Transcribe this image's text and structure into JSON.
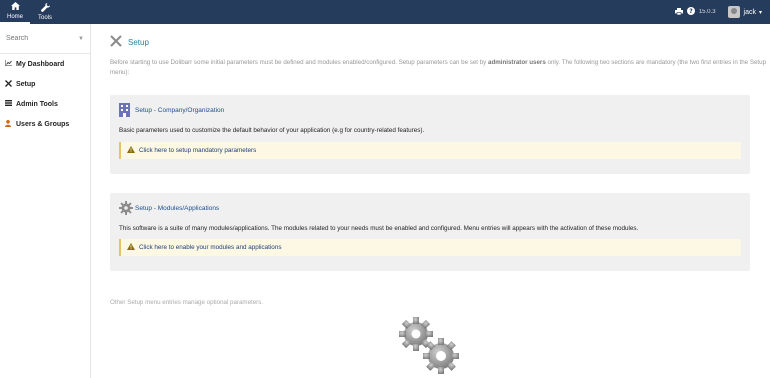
{
  "topnav": {
    "items": [
      {
        "label": "Home",
        "icon": "home-icon",
        "active": true
      },
      {
        "label": "Tools",
        "icon": "wrench-icon",
        "active": false
      }
    ]
  },
  "topright": {
    "print_icon": "print-icon",
    "help_icon": "help-icon",
    "version": "15.0.3",
    "user": "jack",
    "chevron": "▾"
  },
  "sidebar": {
    "search_placeholder": "Search",
    "items": [
      {
        "label": "My Dashboard",
        "icon": "chart-icon"
      },
      {
        "label": "Setup",
        "icon": "tools-icon"
      },
      {
        "label": "Admin Tools",
        "icon": "list-icon"
      },
      {
        "label": "Users & Groups",
        "icon": "user-icon"
      }
    ]
  },
  "main": {
    "title": "Setup",
    "intro_before": "Before starting to use Dolibarr some initial parameters must be defined and modules enabled/configured. Setup parameters can be set by ",
    "intro_bold": "administrator users",
    "intro_after": " only. The following two sections are mandatory (the two first entries in the Setup menu):",
    "panels": [
      {
        "title": "Setup - Company/Organization",
        "icon": "building-icon",
        "description": "Basic parameters used to customize the default behavior of your application (e.g for country-related features).",
        "link": "Click here to setup mandatory parameters"
      },
      {
        "title": "Setup - Modules/Applications",
        "icon": "gear-icon",
        "description": "This software is a suite of many modules/applications. The modules related to your needs must be enabled and configured. Menu entries will appears with the activation of these modules.",
        "link": "Click here to enable your modules and applications"
      }
    ],
    "other": "Other Setup menu entries manage optional parameters."
  },
  "colors": {
    "topbar": "#263c5c",
    "title": "#2d7fa6",
    "panel_title": "#1d4f91",
    "warning_bg": "#fcf8e3"
  }
}
